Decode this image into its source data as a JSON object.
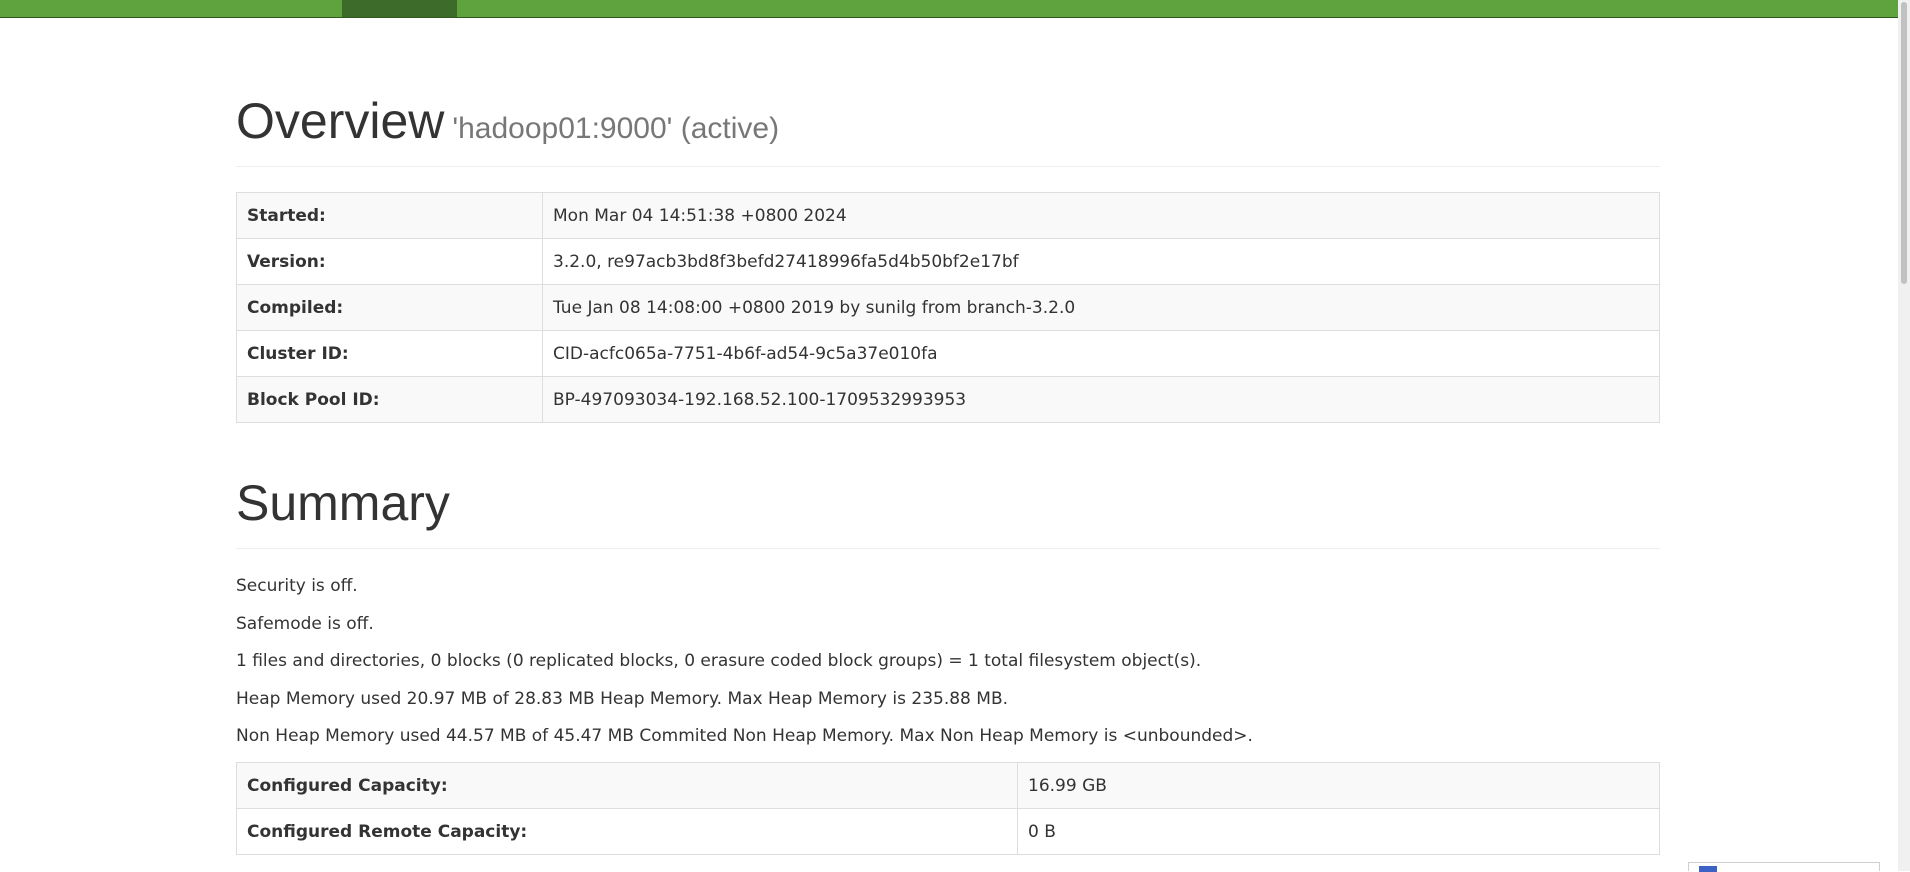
{
  "overview": {
    "title": "Overview",
    "subtitle": "'hadoop01:9000' (active)",
    "rows": [
      {
        "label": "Started:",
        "value": "Mon Mar 04 14:51:38 +0800 2024"
      },
      {
        "label": "Version:",
        "value": "3.2.0, re97acb3bd8f3befd27418996fa5d4b50bf2e17bf"
      },
      {
        "label": "Compiled:",
        "value": "Tue Jan 08 14:08:00 +0800 2019 by sunilg from branch-3.2.0"
      },
      {
        "label": "Cluster ID:",
        "value": "CID-acfc065a-7751-4b6f-ad54-9c5a37e010fa"
      },
      {
        "label": "Block Pool ID:",
        "value": "BP-497093034-192.168.52.100-1709532993953"
      }
    ]
  },
  "summary": {
    "title": "Summary",
    "lines": [
      "Security is off.",
      "Safemode is off.",
      "1 files and directories, 0 blocks (0 replicated blocks, 0 erasure coded block groups) = 1 total filesystem object(s).",
      "Heap Memory used 20.97 MB of 28.83 MB Heap Memory. Max Heap Memory is 235.88 MB.",
      "Non Heap Memory used 44.57 MB of 45.47 MB Commited Non Heap Memory. Max Non Heap Memory is <unbounded>."
    ],
    "rows": [
      {
        "label": "Configured Capacity:",
        "value": "16.99 GB"
      },
      {
        "label": "Configured Remote Capacity:",
        "value": "0 B"
      }
    ]
  },
  "colors": {
    "navbar": "#5fa33e",
    "navbar_active": "#3d6b2a"
  },
  "icons": {
    "corner_widget": "blue-flag-icon"
  }
}
